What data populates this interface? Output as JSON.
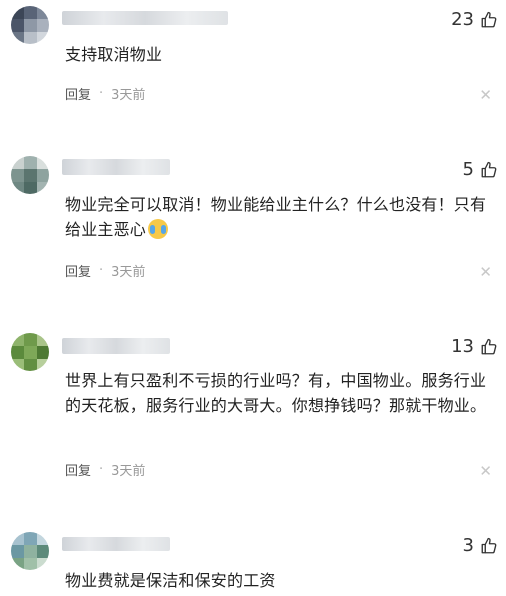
{
  "comments": [
    {
      "likes": "23",
      "text": "支持取消物业",
      "reply_label": "回复",
      "separator": "·",
      "time": "3天前"
    },
    {
      "likes": "5",
      "text": "物业完全可以取消！物业能给业主什么？什么也没有！只有给业主恶心",
      "reply_label": "回复",
      "separator": "·",
      "time": "3天前",
      "emoji": "crying-laughing-emoji"
    },
    {
      "likes": "13",
      "text": "世界上有只盈利不亏损的行业吗？有，中国物业。服务行业的天花板，服务行业的大哥大。你想挣钱吗？那就干物业。",
      "reply_label": "回复",
      "separator": "·",
      "time": "3天前"
    },
    {
      "likes": "3",
      "text": "物业费就是保洁和保安的工资"
    }
  ],
  "icons": {
    "like": "thumbs-up-icon",
    "close": "close-icon"
  },
  "colors": {
    "text": "#222222",
    "meta": "#555555",
    "muted": "#999999"
  }
}
